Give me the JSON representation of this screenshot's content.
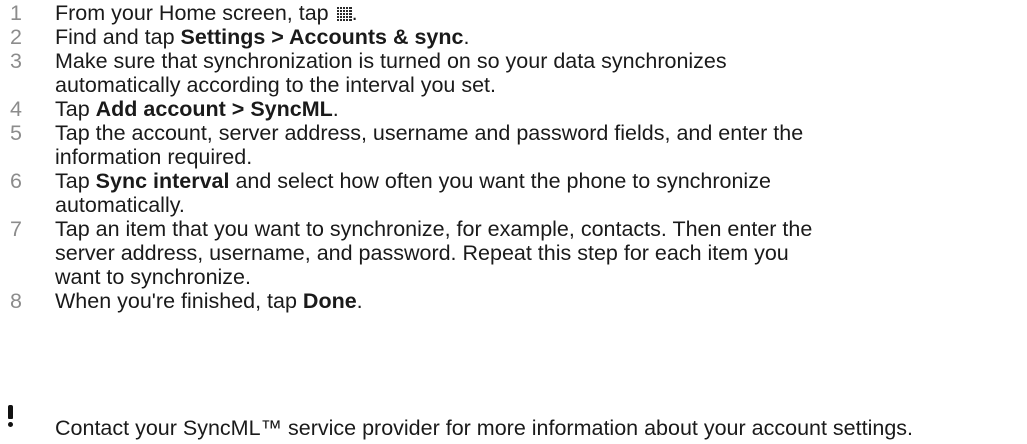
{
  "steps": [
    {
      "number": "1",
      "parts": [
        {
          "t": "From your Home screen, tap "
        },
        {
          "icon": "apps-grid-icon"
        },
        {
          "t": "."
        }
      ]
    },
    {
      "number": "2",
      "parts": [
        {
          "t": "Find and tap "
        },
        {
          "b": "Settings > Accounts & sync"
        },
        {
          "t": "."
        }
      ]
    },
    {
      "number": "3",
      "parts": [
        {
          "t": "Make sure that synchronization is turned on so your data synchronizes"
        },
        {
          "br": true
        },
        {
          "t": "automatically according to the interval you set."
        }
      ]
    },
    {
      "number": "4",
      "parts": [
        {
          "t": "Tap "
        },
        {
          "b": "Add account > SyncML"
        },
        {
          "t": "."
        }
      ]
    },
    {
      "number": "5",
      "parts": [
        {
          "t": "Tap the account, server address, username and password fields, and enter the"
        },
        {
          "br": true
        },
        {
          "t": "information required."
        }
      ]
    },
    {
      "number": "6",
      "parts": [
        {
          "t": "Tap "
        },
        {
          "b": "Sync interval"
        },
        {
          "t": " and select how often you want the phone to synchronize"
        },
        {
          "br": true
        },
        {
          "t": "automatically."
        }
      ]
    },
    {
      "number": "7",
      "parts": [
        {
          "t": "Tap an item that you want to synchronize, for example, contacts. Then enter the"
        },
        {
          "br": true
        },
        {
          "t": "server address, username, and password. Repeat this step for each item you"
        },
        {
          "br": true
        },
        {
          "t": "want to synchronize."
        }
      ]
    },
    {
      "number": "8",
      "parts": [
        {
          "t": "When you're finished, tap "
        },
        {
          "b": "Done"
        },
        {
          "t": "."
        }
      ]
    }
  ],
  "note": {
    "icon": "exclamation-icon",
    "text": "Contact your SyncML™ service provider for more information about your account settings."
  }
}
